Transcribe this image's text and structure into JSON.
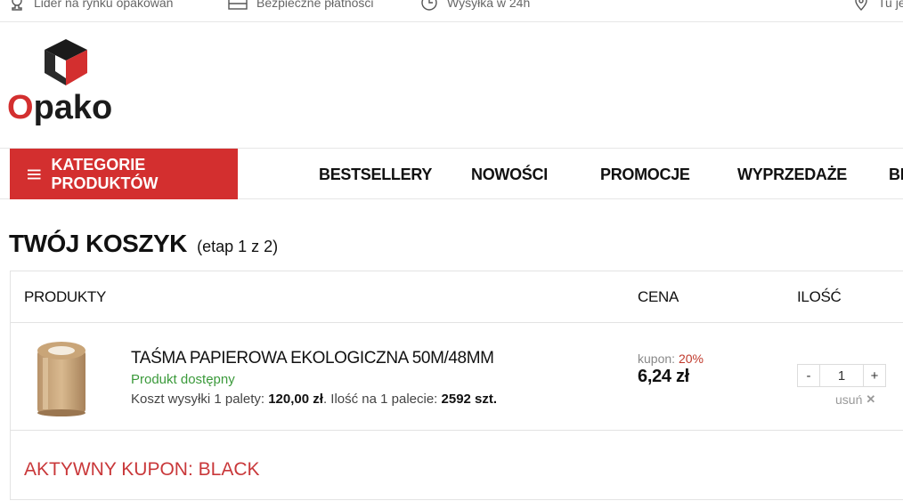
{
  "topbar": {
    "item1": "Lider na rynku opakowań",
    "item2": "Bezpieczne płatności",
    "item3": "Wysyłka w 24h",
    "item4": "Tu je"
  },
  "logo": {
    "letter_o": "O",
    "rest": "pako"
  },
  "nav": {
    "categories_label": "KATEGORIE PRODUKTÓW",
    "links": [
      "BESTSELLERY",
      "NOWOŚCI",
      "PROMOCJE",
      "WYPRZEDAŻE",
      "BL"
    ]
  },
  "page": {
    "title": "TWÓJ KOSZYK",
    "step": "(etap 1 z 2)"
  },
  "cart": {
    "headers": {
      "products": "PRODUKTY",
      "price": "CENA",
      "quantity": "ILOŚĆ"
    },
    "item": {
      "name": "TAŚMA PAPIEROWA EKOLOGICZNA 50M/48MM",
      "availability": "Produkt dostępny",
      "shipping_prefix": "Koszt wysyłki 1 palety: ",
      "shipping_value": "120,00 zł",
      "pallet_prefix": ". Ilość na 1 palecie: ",
      "pallet_value": "2592 szt.",
      "coupon_label": "kupon: ",
      "coupon_pct": "20%",
      "price": "6,24 zł",
      "qty_minus": "-",
      "qty_value": "1",
      "qty_plus": "+",
      "remove_label": "usuń",
      "remove_icon": "close-icon"
    },
    "active_coupon": "AKTYWNY KUPON: BLACK"
  },
  "colors": {
    "accent": "#d32f2f",
    "available": "#3b9a3b",
    "coupon": "#c9383a"
  }
}
